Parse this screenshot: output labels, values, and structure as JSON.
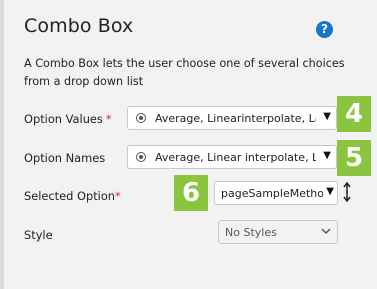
{
  "panel": {
    "title": "Combo Box",
    "description": "A Combo Box lets the user choose one of several choices from a drop down list"
  },
  "fields": {
    "option_values": {
      "label": "Option Values",
      "required": "*",
      "value": "Average, Linearinterpolate, Last...",
      "badge": "4"
    },
    "option_names": {
      "label": "Option Names",
      "value": "Average, Linear interpolate, Las...",
      "badge": "5"
    },
    "selected_option": {
      "label": "Selected Option",
      "required": "*",
      "value": "pageSampleMethod",
      "badge": "6"
    },
    "style": {
      "label": "Style",
      "value": "No Styles"
    }
  },
  "icons": {
    "help": "question-circle-icon",
    "dot": "radio-dot-icon",
    "dropdown": "caret-down-icon",
    "resize": "vertical-resize-icon",
    "chevron": "chevron-down-icon"
  },
  "colors": {
    "accent_badge": "#8bc43f",
    "help": "#1976c7",
    "required": "#d32f2f"
  }
}
